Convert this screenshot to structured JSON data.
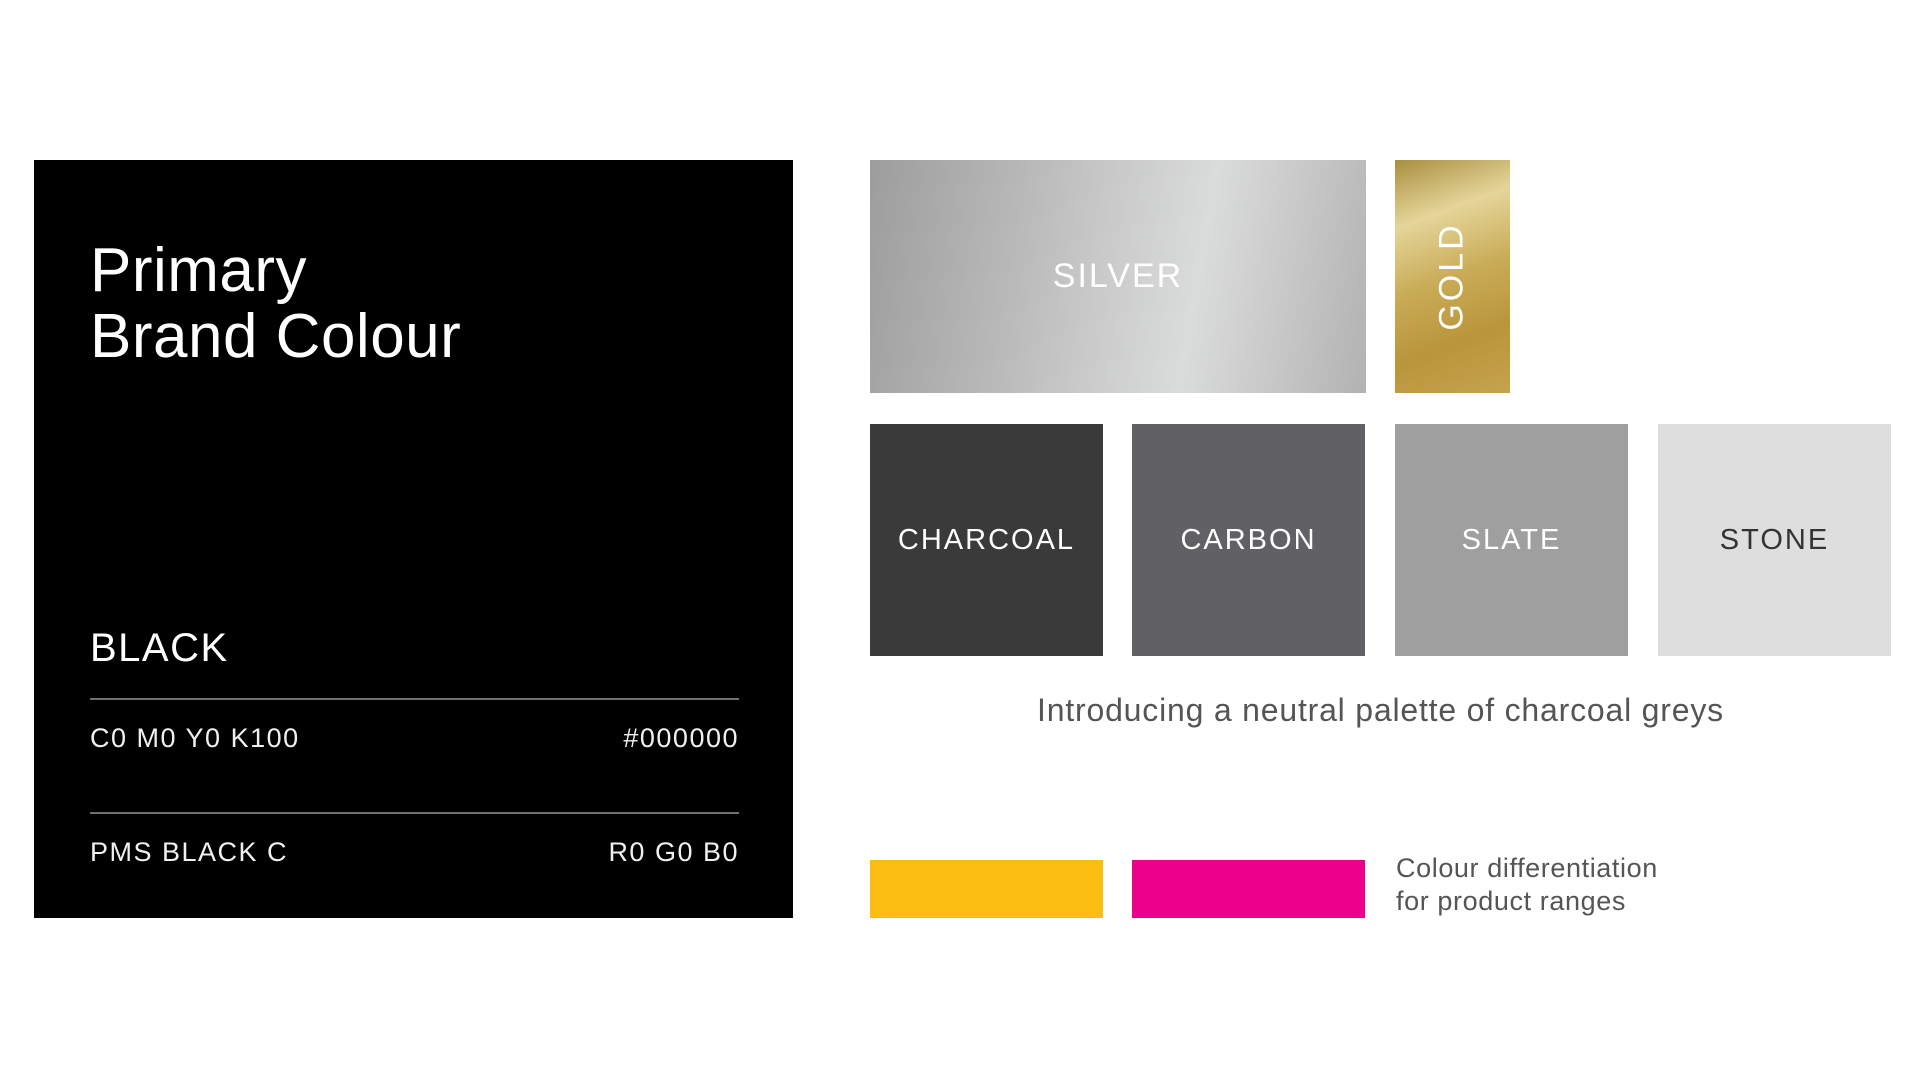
{
  "primary": {
    "title_line1": "Primary",
    "title_line2": "Brand Colour",
    "colour_name": "BLACK",
    "cmyk": "C0 M0 Y0 K100",
    "hex": "#000000",
    "pms": "PMS BLACK C",
    "rgb": "R0 G0 B0",
    "color": "#000000"
  },
  "metallics": [
    {
      "label": "SILVER",
      "color": "#c8c9c9"
    },
    {
      "label": "GOLD",
      "color": "#c6a44c"
    }
  ],
  "greys": [
    {
      "label": "CHARCOAL",
      "color": "#3a3a3a"
    },
    {
      "label": "CARBON",
      "color": "#616165"
    },
    {
      "label": "SLATE",
      "color": "#9f9f9f"
    },
    {
      "label": "STONE",
      "color": "#dedede"
    }
  ],
  "neutral_caption": "Introducing a neutral palette of charcoal greys",
  "accents": [
    {
      "color": "#fcbd13"
    },
    {
      "color": "#ec008c"
    }
  ],
  "accent_caption_line1": "Colour differentiation",
  "accent_caption_line2": "for product ranges"
}
